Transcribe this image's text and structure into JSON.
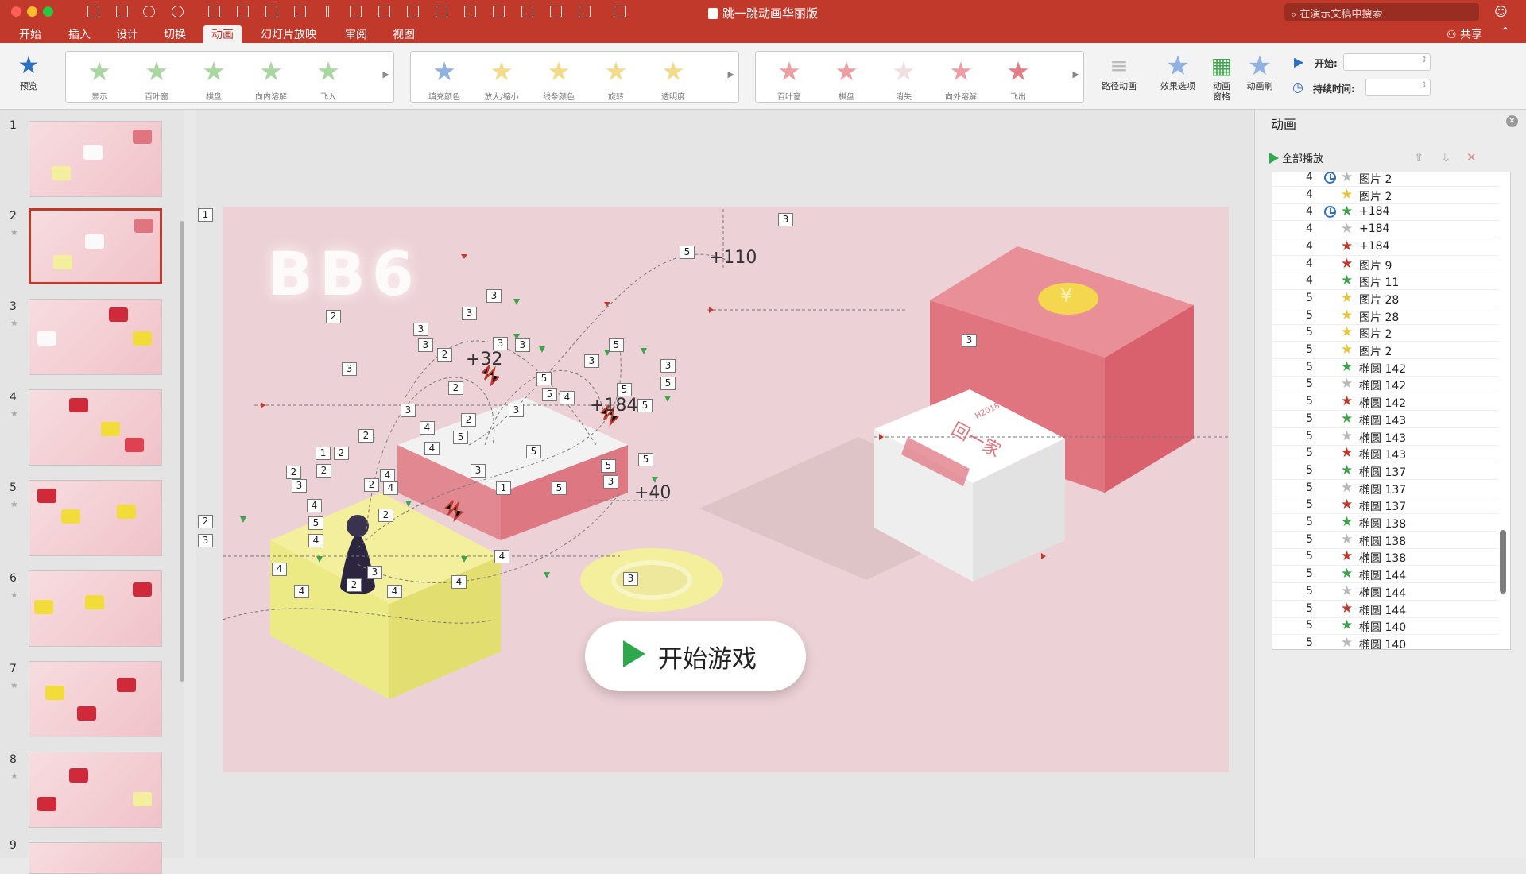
{
  "window": {
    "title": "跳一跳动画华丽版",
    "search_placeholder": "在演示文稿中搜索"
  },
  "menu_tabs": [
    "开始",
    "插入",
    "设计",
    "切换",
    "动画",
    "幻灯片放映",
    "审阅",
    "视图"
  ],
  "active_tab": "动画",
  "share_label": "共享",
  "ribbon": {
    "preview": "预览",
    "entrance_effects": [
      "显示",
      "百叶窗",
      "棋盘",
      "向内溶解",
      "飞入"
    ],
    "emphasis_effects": [
      "填充颜色",
      "放大/缩小",
      "线条颜色",
      "旋转",
      "透明度"
    ],
    "exit_effects": [
      "百叶窗",
      "棋盘",
      "消失",
      "向外溶解",
      "飞出"
    ],
    "path_animation": "路径动画",
    "effect_options": "效果选项",
    "animation_pane": "动画\n窗格",
    "animation_painter": "动画刷",
    "start_label": "开始:",
    "duration_label": "持续时间:"
  },
  "slide_numbers": [
    "1",
    "2",
    "3",
    "4",
    "5",
    "6",
    "7",
    "8",
    "9"
  ],
  "selected_slide": "2",
  "slide": {
    "logo_text": "BB6",
    "scores": [
      "+110",
      "+32",
      "+184",
      "+40"
    ],
    "start_button": "开始游戏",
    "box_label": "回一家",
    "box_code": "H2018",
    "coin_symbol": "¥",
    "number_badges": [
      "1",
      "2",
      "3",
      "2",
      "3",
      "3",
      "3",
      "3",
      "3",
      "2",
      "3",
      "3",
      "2",
      "3",
      "3",
      "5",
      "5",
      "3",
      "5",
      "5",
      "5",
      "4",
      "5",
      "3",
      "5",
      "2",
      "4",
      "2",
      "5",
      "4",
      "1",
      "2",
      "2",
      "3",
      "2",
      "4",
      "4",
      "5",
      "4",
      "2",
      "4",
      "2",
      "4",
      "4",
      "3",
      "1",
      "4",
      "4",
      "5",
      "5",
      "3",
      "3",
      "3",
      "5",
      "5"
    ]
  },
  "animation_pane": {
    "title": "动画",
    "play_all": "全部播放",
    "rows": [
      {
        "n": "4",
        "clock": true,
        "color": "#b7b7b7",
        "name": "图片 2"
      },
      {
        "n": "4",
        "clock": false,
        "color": "#e6c43c",
        "name": "图片 2"
      },
      {
        "n": "4",
        "clock": true,
        "color": "#3fa34d",
        "name": "+184"
      },
      {
        "n": "4",
        "clock": false,
        "color": "#b7b7b7",
        "name": "+184"
      },
      {
        "n": "4",
        "clock": false,
        "color": "#c0392b",
        "name": "+184"
      },
      {
        "n": "4",
        "clock": false,
        "color": "#c0392b",
        "name": "图片 9"
      },
      {
        "n": "4",
        "clock": false,
        "color": "#3fa34d",
        "name": "图片 11"
      },
      {
        "n": "5",
        "clock": false,
        "color": "#e6c43c",
        "name": "图片 28"
      },
      {
        "n": "5",
        "clock": false,
        "color": "#e6c43c",
        "name": "图片 28"
      },
      {
        "n": "5",
        "clock": false,
        "color": "#e6c43c",
        "name": "图片 2"
      },
      {
        "n": "5",
        "clock": false,
        "color": "#e6c43c",
        "name": "图片 2"
      },
      {
        "n": "5",
        "clock": false,
        "color": "#3fa34d",
        "name": "椭圆 142"
      },
      {
        "n": "5",
        "clock": false,
        "color": "#b7b7b7",
        "name": "椭圆 142"
      },
      {
        "n": "5",
        "clock": false,
        "color": "#c0392b",
        "name": "椭圆 142"
      },
      {
        "n": "5",
        "clock": false,
        "color": "#3fa34d",
        "name": "椭圆 143"
      },
      {
        "n": "5",
        "clock": false,
        "color": "#b7b7b7",
        "name": "椭圆 143"
      },
      {
        "n": "5",
        "clock": false,
        "color": "#c0392b",
        "name": "椭圆 143"
      },
      {
        "n": "5",
        "clock": false,
        "color": "#3fa34d",
        "name": "椭圆 137"
      },
      {
        "n": "5",
        "clock": false,
        "color": "#b7b7b7",
        "name": "椭圆 137"
      },
      {
        "n": "5",
        "clock": false,
        "color": "#c0392b",
        "name": "椭圆 137"
      },
      {
        "n": "5",
        "clock": false,
        "color": "#3fa34d",
        "name": "椭圆 138"
      },
      {
        "n": "5",
        "clock": false,
        "color": "#b7b7b7",
        "name": "椭圆 138"
      },
      {
        "n": "5",
        "clock": false,
        "color": "#c0392b",
        "name": "椭圆 138"
      },
      {
        "n": "5",
        "clock": false,
        "color": "#3fa34d",
        "name": "椭圆 144"
      },
      {
        "n": "5",
        "clock": false,
        "color": "#b7b7b7",
        "name": "椭圆 144"
      },
      {
        "n": "5",
        "clock": false,
        "color": "#c0392b",
        "name": "椭圆 144"
      },
      {
        "n": "5",
        "clock": false,
        "color": "#3fa34d",
        "name": "椭圆 140"
      },
      {
        "n": "5",
        "clock": false,
        "color": "#b7b7b7",
        "name": "椭圆 140"
      }
    ]
  },
  "colors": {
    "brand": "#c0392b",
    "slide_bg": "#ecd2d6",
    "green": "#2ea84d"
  }
}
